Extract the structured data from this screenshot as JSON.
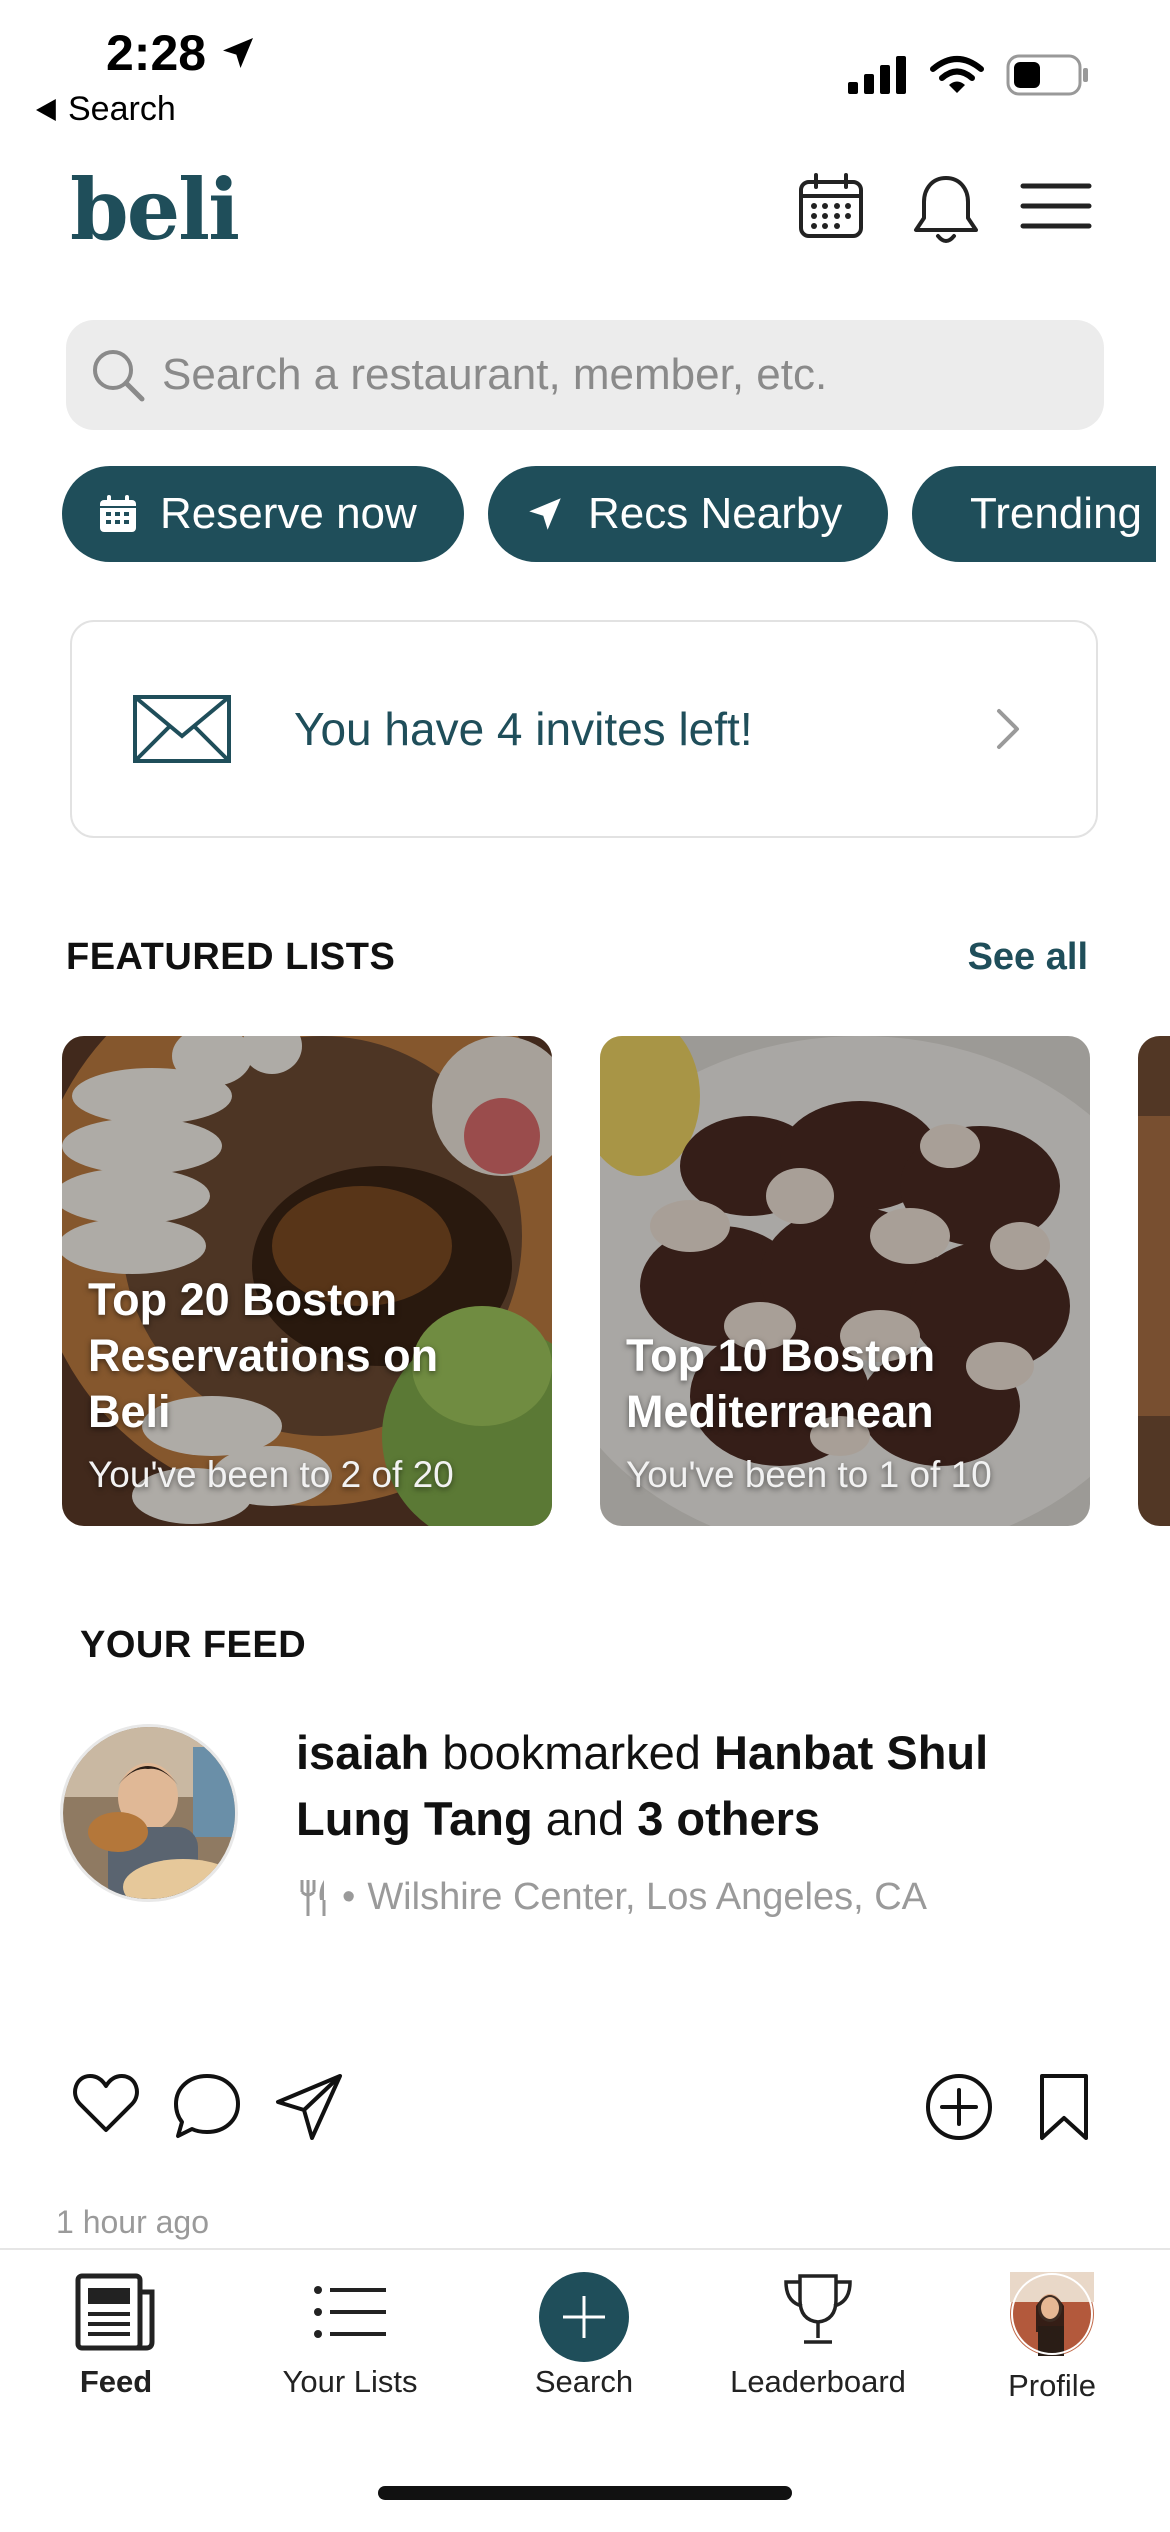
{
  "status_bar": {
    "time": "2:28",
    "back_label": "Search"
  },
  "header": {
    "logo": "beli"
  },
  "search": {
    "placeholder": "Search a restaurant, member, etc."
  },
  "chips": [
    {
      "label": "Reserve now",
      "icon": "calendar-icon"
    },
    {
      "label": "Recs Nearby",
      "icon": "navigation-arrow-icon"
    },
    {
      "label": "Trending",
      "icon": "trending-icon"
    }
  ],
  "invite": {
    "text": "You have 4 invites left!"
  },
  "featured": {
    "title": "FEATURED LISTS",
    "see_all": "See all",
    "cards": [
      {
        "title": "Top 20 Boston Reservations on Beli",
        "subtitle": "You've been to 2 of 20"
      },
      {
        "title": "Top 10 Boston Mediterranean",
        "subtitle": "You've been to 1 of 10"
      }
    ]
  },
  "feed": {
    "title": "YOUR FEED",
    "item": {
      "user": "isaiah",
      "action": " bookmarked ",
      "restaurant_line1": "Hanbat Shul",
      "restaurant_line2": "Lung Tang",
      "connector": " and ",
      "others": "3 others",
      "location": "Wilshire Center, Los Angeles, CA",
      "timestamp": "1 hour ago"
    }
  },
  "tabbar": {
    "tabs": [
      {
        "label": "Feed",
        "icon": "newspaper-icon",
        "active": true
      },
      {
        "label": "Your Lists",
        "icon": "list-icon"
      },
      {
        "label": "Search",
        "icon": "plus-icon"
      },
      {
        "label": "Leaderboard",
        "icon": "trophy-icon"
      },
      {
        "label": "Profile",
        "icon": "profile-avatar"
      }
    ]
  },
  "colors": {
    "brand": "#1f4e5a",
    "search_bg": "#ececec",
    "muted": "#9a9a9a"
  }
}
